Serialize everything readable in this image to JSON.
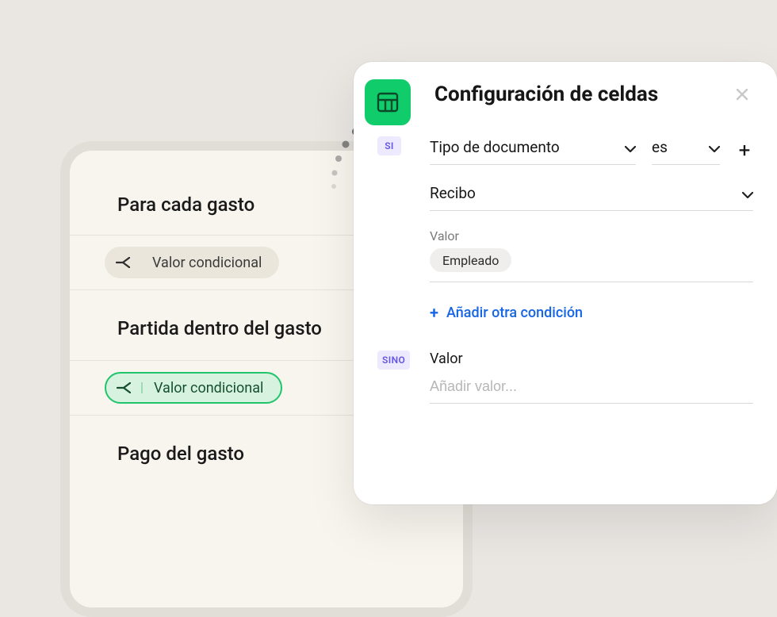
{
  "left": {
    "section1_title": "Para cada gasto",
    "pill1_label": "Valor condicional",
    "section2_title": "Partida dentro del gasto",
    "pill2_label": "Valor condicional",
    "section3_title": "Pago del gasto"
  },
  "panel": {
    "title": "Configuración de celdas",
    "si": {
      "badge": "SI",
      "field_select": "Tipo de documento",
      "op_select": "es",
      "value_select": "Recibo",
      "value_label": "Valor",
      "chip": "Empleado",
      "add_condition": "Añadir otra condición"
    },
    "sino": {
      "badge": "SINO",
      "value_label": "Valor",
      "placeholder": "Añadir valor..."
    }
  }
}
